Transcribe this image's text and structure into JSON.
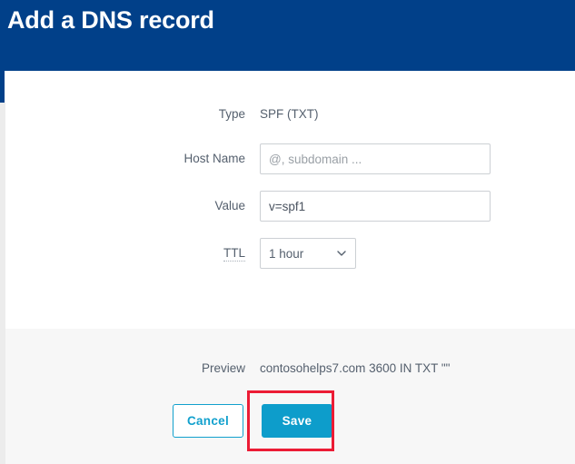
{
  "header": {
    "title": "Add a DNS record",
    "background_color": "#014089",
    "title_color": "#ffffff"
  },
  "form": {
    "rows": [
      {
        "label": "Type",
        "kind": "static",
        "value": "SPF (TXT)",
        "name": "type"
      },
      {
        "label": "Host Name",
        "kind": "text",
        "value": "",
        "placeholder": "@, subdomain ...",
        "name": "host-name"
      },
      {
        "label": "Value",
        "kind": "text",
        "value": "v=spf1",
        "placeholder": "",
        "name": "value"
      },
      {
        "label": "TTL",
        "kind": "select",
        "value": "1 hour",
        "options": [
          "1 hour"
        ],
        "has_tooltip_underline": true,
        "name": "ttl"
      }
    ]
  },
  "footer": {
    "preview_label": "Preview",
    "preview_value": "contosohelps7.com  3600  IN  TXT  \"\"",
    "cancel_label": "Cancel",
    "save_label": "Save",
    "background_color": "#f7f7f7",
    "accent_color": "#0d9dcb"
  },
  "annotation": {
    "target": "save-button",
    "color": "#ec1c35"
  },
  "icons": {
    "chevron_down": "chevron-down-icon"
  }
}
